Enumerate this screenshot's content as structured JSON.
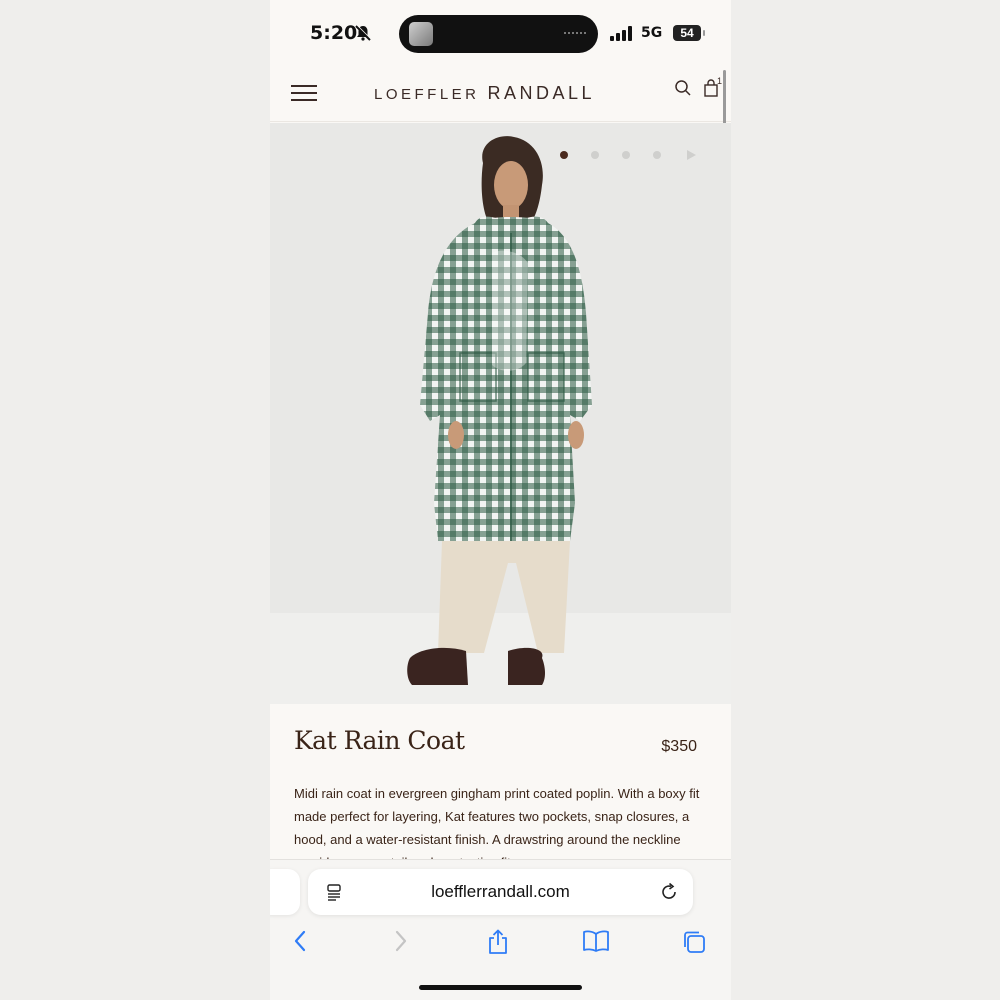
{
  "status_bar": {
    "time": "5:20",
    "network": "5G",
    "battery": "54"
  },
  "header": {
    "logo_part1": "LOEFFLER",
    "logo_part2": "RANDALL",
    "cart_count": "1"
  },
  "carousel": {
    "slide_count": 4,
    "active_slide": 1
  },
  "product": {
    "name": "Kat Rain Coat",
    "price": "$350",
    "description": "Midi rain coat in evergreen gingham print coated poplin. With a boxy fit made perfect for layering, Kat features two pockets, snap closures, a hood, and a water-resistant finish. A drawstring around the neckline provides a more tailored, protective fit."
  },
  "browser": {
    "url": "loefflerrandall.com"
  },
  "colors": {
    "brand_brown": "#3a2418",
    "gingham_green": "#2e5a44",
    "safari_blue": "#2f7cf6"
  },
  "icons": {
    "menu": "hamburger-icon",
    "search": "search-icon",
    "bag": "shopping-bag-icon",
    "reader": "reader-mode-icon",
    "reload": "reload-icon",
    "back": "back-chevron-icon",
    "forward": "forward-chevron-icon",
    "share": "share-icon",
    "bookmarks": "bookmarks-icon",
    "tabs": "tabs-icon"
  }
}
